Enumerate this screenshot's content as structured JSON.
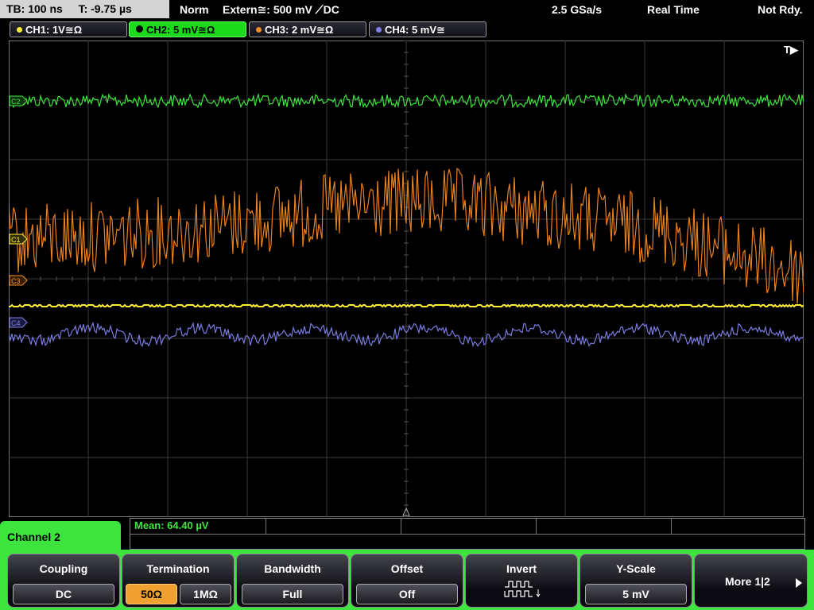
{
  "status": {
    "timebase": "TB: 100 ns",
    "trigger_pos": "T: -9.75 µs",
    "trigger_mode": "Norm",
    "trigger_source": "Extern≅: 500 mV ⟋DC",
    "sample_rate": "2.5 GSa/s",
    "acq_mode": "Real Time",
    "state": "Not Rdy."
  },
  "channels": [
    {
      "label": "CH1: 1V≅Ω",
      "color": "#ffee33"
    },
    {
      "label": "CH2: 5 mV≅Ω",
      "color": "#3ee43e"
    },
    {
      "label": "CH3: 2 mV≅Ω",
      "color": "#f08c2a"
    },
    {
      "label": "CH4: 5 mV≅",
      "color": "#8080e8"
    }
  ],
  "trace_markers": {
    "c1": "C1",
    "c2": "C2",
    "c3": "C3",
    "c4": "C4",
    "trigger": "T▶"
  },
  "panel": {
    "title": "Channel 2",
    "measurement": "Mean: 64.40 µV"
  },
  "softkeys": {
    "coupling": {
      "title": "Coupling",
      "value": "DC"
    },
    "termination": {
      "title": "Termination",
      "options": [
        "50Ω",
        "1MΩ"
      ],
      "selected": "50Ω"
    },
    "bandwidth": {
      "title": "Bandwidth",
      "value": "Full"
    },
    "offset": {
      "title": "Offset",
      "value": "Off"
    },
    "invert": {
      "title": "Invert",
      "icon": "invert-waveform-icon"
    },
    "yscale": {
      "title": "Y-Scale",
      "value": "5 mV"
    },
    "more": {
      "label": "More 1|2",
      "icon": "arrow-right-icon"
    }
  }
}
